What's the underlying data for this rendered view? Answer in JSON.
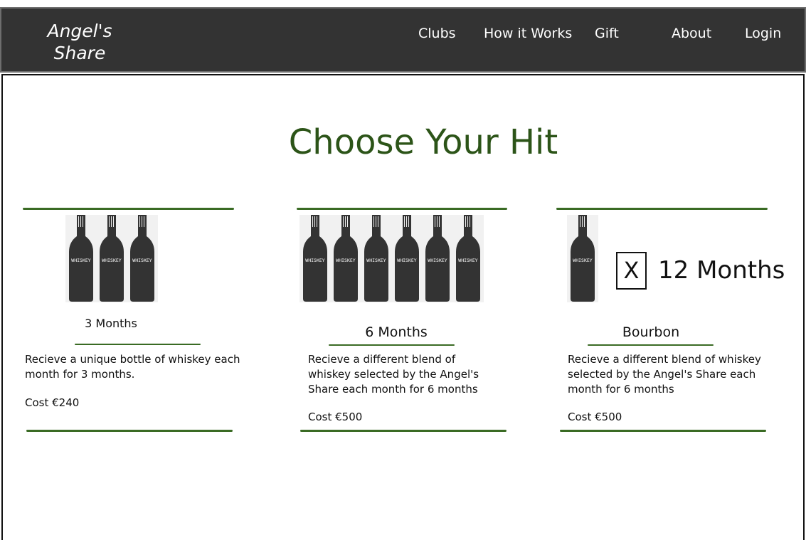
{
  "nav": {
    "logo": "Angel's Share",
    "links": [
      "Clubs",
      "How it Works",
      "Gift",
      "About",
      "Login"
    ]
  },
  "page": {
    "title": "Choose Your Hit"
  },
  "bottle_label": "WHISKEY",
  "cards": [
    {
      "title": "3 Months",
      "description": "Recieve a unique bottle of whiskey each month for 3 months.",
      "cost": "Cost €240",
      "bottle_count": 3
    },
    {
      "title": "6 Months",
      "description": "Recieve a different blend of whiskey selected by the Angel's Share each month for 6 months",
      "cost": "Cost €500",
      "bottle_count": 6
    },
    {
      "title": "Bourbon",
      "description": "Recieve a different blend of whiskey selected by the Angel's Share each month for 6 months",
      "cost": "Cost €500",
      "bottle_count": 1
    }
  ],
  "option": {
    "mark": "X",
    "label": "12 Months"
  },
  "colors": {
    "navbar": "#333333",
    "accent": "#2c5418",
    "rule": "#3a6b24",
    "bottle": "#333333"
  }
}
